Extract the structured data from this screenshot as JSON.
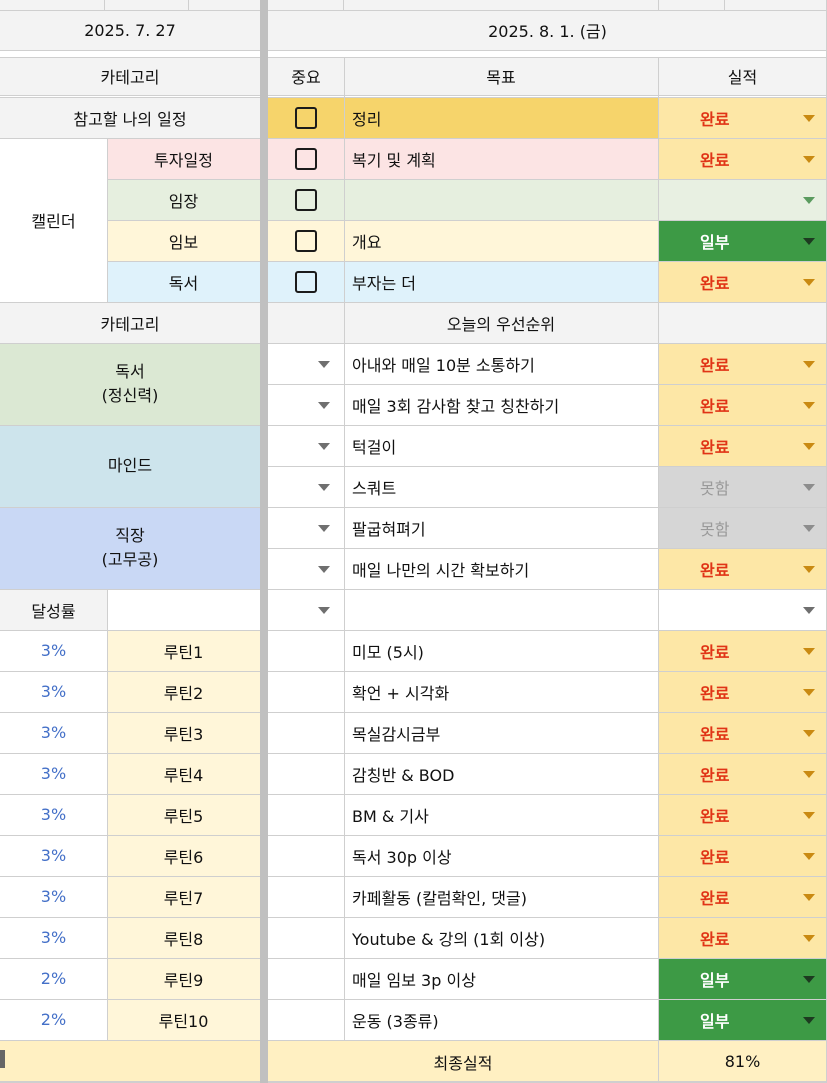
{
  "header": {
    "left_date": "2025. 7. 27",
    "right_date": "2025. 8. 1. (금)"
  },
  "col_headers": {
    "category": "카테고리",
    "importance": "중요",
    "goal": "목표",
    "result": "실적"
  },
  "calendar": {
    "reference_label": "참고할 나의 일정",
    "group_label": "캘린더",
    "items": [
      {
        "label": "투자일정",
        "goal": "복기 및 계획",
        "result": "완료",
        "color": "#fce4e4"
      },
      {
        "label": "임장",
        "goal": "",
        "result": "",
        "color": "#e6efdf"
      },
      {
        "label": "임보",
        "goal": "개요",
        "result": "일부",
        "color": "#fff6d9"
      },
      {
        "label": "독서",
        "goal": "부자는 더",
        "result": "완료",
        "color": "#dff2fb"
      }
    ],
    "reference_goal": "정리",
    "reference_result": "완료"
  },
  "priority_section": {
    "category_label": "카테고리",
    "header": "오늘의 우선순위",
    "groups": [
      {
        "label": "독서\n(정신력)",
        "color": "#dbe8d3"
      },
      {
        "label": "마인드",
        "color": "#cde4ec"
      },
      {
        "label": "직장\n(고무공)",
        "color": "#c9d8f5"
      }
    ],
    "items": [
      {
        "goal": "아내와 매일 10분 소통하기",
        "result": "완료"
      },
      {
        "goal": "매일 3회 감사함 찾고 칭찬하기",
        "result": "완료"
      },
      {
        "goal": "턱걸이",
        "result": "완료"
      },
      {
        "goal": "스쿼트",
        "result": "못함"
      },
      {
        "goal": "팔굽혀펴기",
        "result": "못함"
      },
      {
        "goal": "매일 나만의 시간 확보하기",
        "result": "완료"
      }
    ]
  },
  "achievement_label": "달성률",
  "routines": [
    {
      "pct": "3%",
      "name": "루틴1",
      "goal": "미모 (5시)",
      "result": "완료"
    },
    {
      "pct": "3%",
      "name": "루틴2",
      "goal": "확언 + 시각화",
      "result": "완료"
    },
    {
      "pct": "3%",
      "name": "루틴3",
      "goal": "목실감시금부",
      "result": "완료"
    },
    {
      "pct": "3%",
      "name": "루틴4",
      "goal": "감칭반 & BOD",
      "result": "완료"
    },
    {
      "pct": "3%",
      "name": "루틴5",
      "goal": "BM & 기사",
      "result": "완료"
    },
    {
      "pct": "3%",
      "name": "루틴6",
      "goal": "독서 30p 이상",
      "result": "완료"
    },
    {
      "pct": "3%",
      "name": "루틴7",
      "goal": "카페활동 (칼럼확인, 댓글)",
      "result": "완료"
    },
    {
      "pct": "3%",
      "name": "루틴8",
      "goal": "Youtube & 강의 (1회 이상)",
      "result": "완료"
    },
    {
      "pct": "2%",
      "name": "루틴9",
      "goal": "매일 임보 3p 이상",
      "result": "일부"
    },
    {
      "pct": "2%",
      "name": "루틴10",
      "goal": "운동 (3종류)",
      "result": "일부"
    }
  ],
  "final": {
    "label": "최종실적",
    "value": "81%"
  },
  "colors": {
    "done_bg": "#fde7a6",
    "done_text": "#e03416",
    "partial_bg": "#3d9a45",
    "fail_bg": "#d6d6d6",
    "reference_bg": "#f6d46b",
    "routine_bg": "#fff6d9"
  }
}
